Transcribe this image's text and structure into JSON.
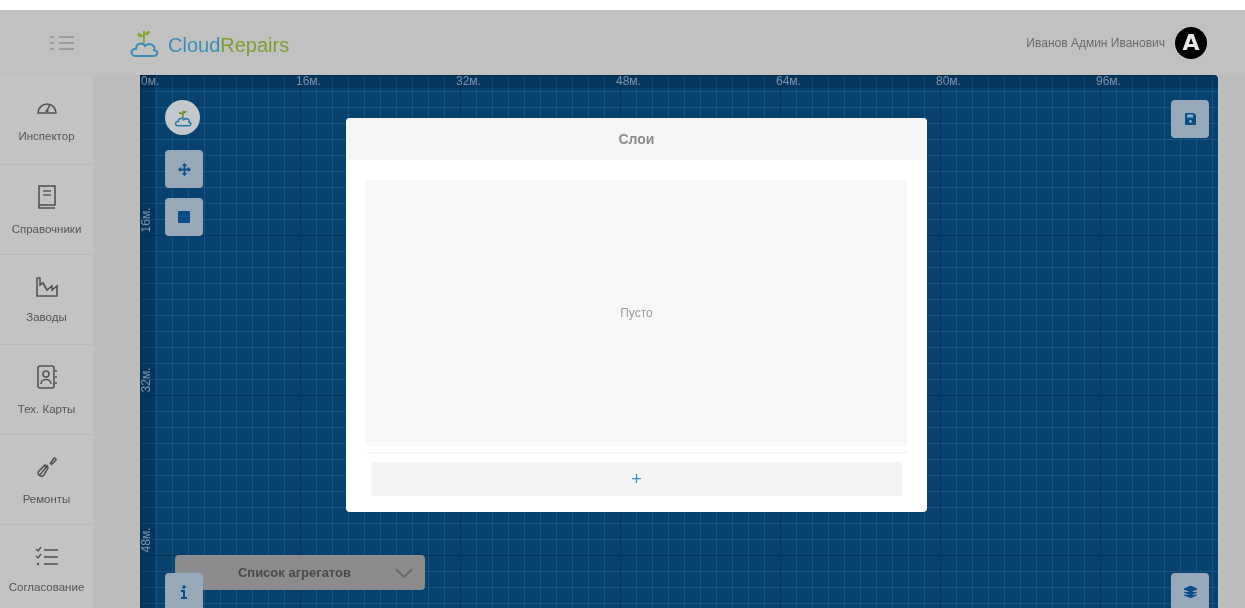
{
  "header": {
    "logo": {
      "part_1": "Cloud",
      "part_2": "Repairs"
    },
    "user": {
      "name": "Иванов Админ Иванович",
      "avatar_letter": "A"
    }
  },
  "sidebar": {
    "items": [
      {
        "label": "Инспектор",
        "kind": "gauge"
      },
      {
        "label": "Справочники",
        "kind": "book"
      },
      {
        "label": "Заводы",
        "kind": "factory"
      },
      {
        "label": "Тех. Карты",
        "kind": "contacts"
      },
      {
        "label": "Ремонты",
        "kind": "wrench"
      },
      {
        "label": "Согласование",
        "kind": "checklist"
      }
    ]
  },
  "canvas": {
    "x_ruler": [
      "0м.",
      "16м.",
      "32м.",
      "48м.",
      "64м.",
      "80м.",
      "96м."
    ],
    "y_ruler": [
      "16м.",
      "32м.",
      "48м."
    ],
    "dropdown": {
      "label": "Список агрегатов"
    }
  },
  "modal": {
    "title": "Слои",
    "empty_text": "Пусто",
    "add_button": "+"
  }
}
